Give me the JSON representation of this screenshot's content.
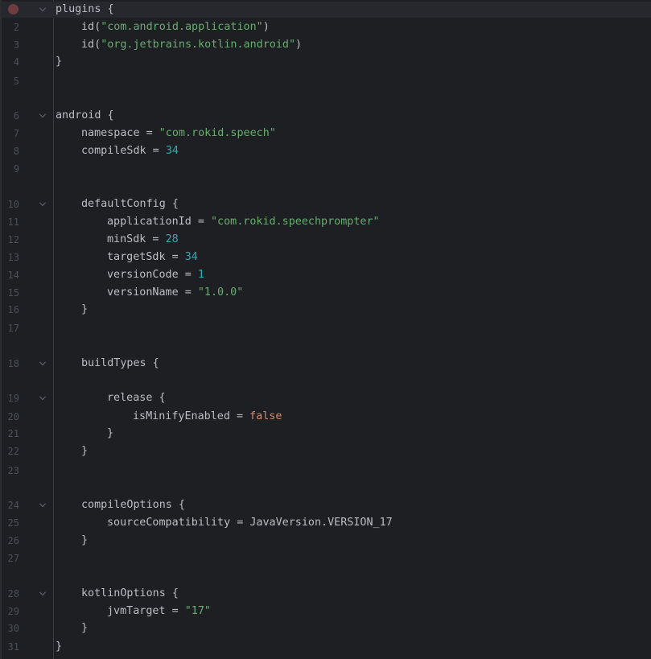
{
  "editor": {
    "lines": [
      {
        "num": "1",
        "indent": 0,
        "parts": [
          {
            "t": "plugins {",
            "c": "p"
          }
        ],
        "fold": true,
        "breakpoint": true,
        "current": true
      },
      {
        "num": "2",
        "indent": 1,
        "parts": [
          {
            "t": "id(",
            "c": "p"
          },
          {
            "t": "\"com.android.application\"",
            "c": "s"
          },
          {
            "t": ")",
            "c": "p"
          }
        ]
      },
      {
        "num": "3",
        "indent": 1,
        "parts": [
          {
            "t": "id(",
            "c": "p"
          },
          {
            "t": "\"org.jetbrains.kotlin.android\"",
            "c": "s"
          },
          {
            "t": ")",
            "c": "p"
          }
        ]
      },
      {
        "num": "4",
        "indent": 0,
        "parts": [
          {
            "t": "}",
            "c": "p"
          }
        ]
      },
      {
        "num": "5",
        "indent": 0,
        "parts": []
      },
      {
        "num": "6",
        "indent": 0,
        "parts": [
          {
            "t": "android {",
            "c": "p"
          }
        ],
        "fold": true
      },
      {
        "num": "7",
        "indent": 1,
        "parts": [
          {
            "t": "namespace = ",
            "c": "p"
          },
          {
            "t": "\"com.rokid.speech\"",
            "c": "s"
          }
        ]
      },
      {
        "num": "8",
        "indent": 1,
        "parts": [
          {
            "t": "compileSdk = ",
            "c": "p"
          },
          {
            "t": "34",
            "c": "n"
          }
        ]
      },
      {
        "num": "9",
        "indent": 0,
        "parts": []
      },
      {
        "num": "10",
        "indent": 1,
        "parts": [
          {
            "t": "defaultConfig {",
            "c": "p"
          }
        ],
        "fold": true
      },
      {
        "num": "11",
        "indent": 2,
        "parts": [
          {
            "t": "applicationId = ",
            "c": "p"
          },
          {
            "t": "\"com.rokid.speechprompter\"",
            "c": "s"
          }
        ]
      },
      {
        "num": "12",
        "indent": 2,
        "parts": [
          {
            "t": "minSdk = ",
            "c": "p"
          },
          {
            "t": "28",
            "c": "n"
          }
        ]
      },
      {
        "num": "13",
        "indent": 2,
        "parts": [
          {
            "t": "targetSdk = ",
            "c": "p"
          },
          {
            "t": "34",
            "c": "n"
          }
        ]
      },
      {
        "num": "14",
        "indent": 2,
        "parts": [
          {
            "t": "versionCode = ",
            "c": "p"
          },
          {
            "t": "1",
            "c": "n"
          }
        ]
      },
      {
        "num": "15",
        "indent": 2,
        "parts": [
          {
            "t": "versionName = ",
            "c": "p"
          },
          {
            "t": "\"1.0.0\"",
            "c": "s"
          }
        ]
      },
      {
        "num": "16",
        "indent": 1,
        "parts": [
          {
            "t": "}",
            "c": "p"
          }
        ]
      },
      {
        "num": "17",
        "indent": 0,
        "parts": []
      },
      {
        "num": "18",
        "indent": 1,
        "parts": [
          {
            "t": "buildTypes {",
            "c": "p"
          }
        ],
        "fold": true
      },
      {
        "num": "19",
        "indent": 2,
        "parts": [
          {
            "t": "release {",
            "c": "p"
          }
        ],
        "fold": true
      },
      {
        "num": "20",
        "indent": 3,
        "parts": [
          {
            "t": "isMinifyEnabled = ",
            "c": "p"
          },
          {
            "t": "false",
            "c": "k"
          }
        ]
      },
      {
        "num": "21",
        "indent": 2,
        "parts": [
          {
            "t": "}",
            "c": "p"
          }
        ]
      },
      {
        "num": "22",
        "indent": 1,
        "parts": [
          {
            "t": "}",
            "c": "p"
          }
        ]
      },
      {
        "num": "23",
        "indent": 0,
        "parts": []
      },
      {
        "num": "24",
        "indent": 1,
        "parts": [
          {
            "t": "compileOptions {",
            "c": "p"
          }
        ],
        "fold": true
      },
      {
        "num": "25",
        "indent": 2,
        "parts": [
          {
            "t": "sourceCompatibility = JavaVersion.VERSION_17",
            "c": "p"
          }
        ]
      },
      {
        "num": "26",
        "indent": 1,
        "parts": [
          {
            "t": "}",
            "c": "p"
          }
        ]
      },
      {
        "num": "27",
        "indent": 0,
        "parts": []
      },
      {
        "num": "28",
        "indent": 1,
        "parts": [
          {
            "t": "kotlinOptions {",
            "c": "p"
          }
        ],
        "fold": true
      },
      {
        "num": "29",
        "indent": 2,
        "parts": [
          {
            "t": "jvmTarget = ",
            "c": "p"
          },
          {
            "t": "\"17\"",
            "c": "s"
          }
        ]
      },
      {
        "num": "30",
        "indent": 1,
        "parts": [
          {
            "t": "}",
            "c": "p"
          }
        ]
      },
      {
        "num": "31",
        "indent": 0,
        "parts": [
          {
            "t": "}",
            "c": "p"
          }
        ]
      }
    ]
  },
  "colors": {
    "background": "#1e1f22",
    "text": "#bcbec4",
    "string": "#6aab73",
    "number": "#2aacb8",
    "keyword": "#cf8e6d",
    "line_number": "#4b5059",
    "breakpoint": "#6e3b3e"
  }
}
